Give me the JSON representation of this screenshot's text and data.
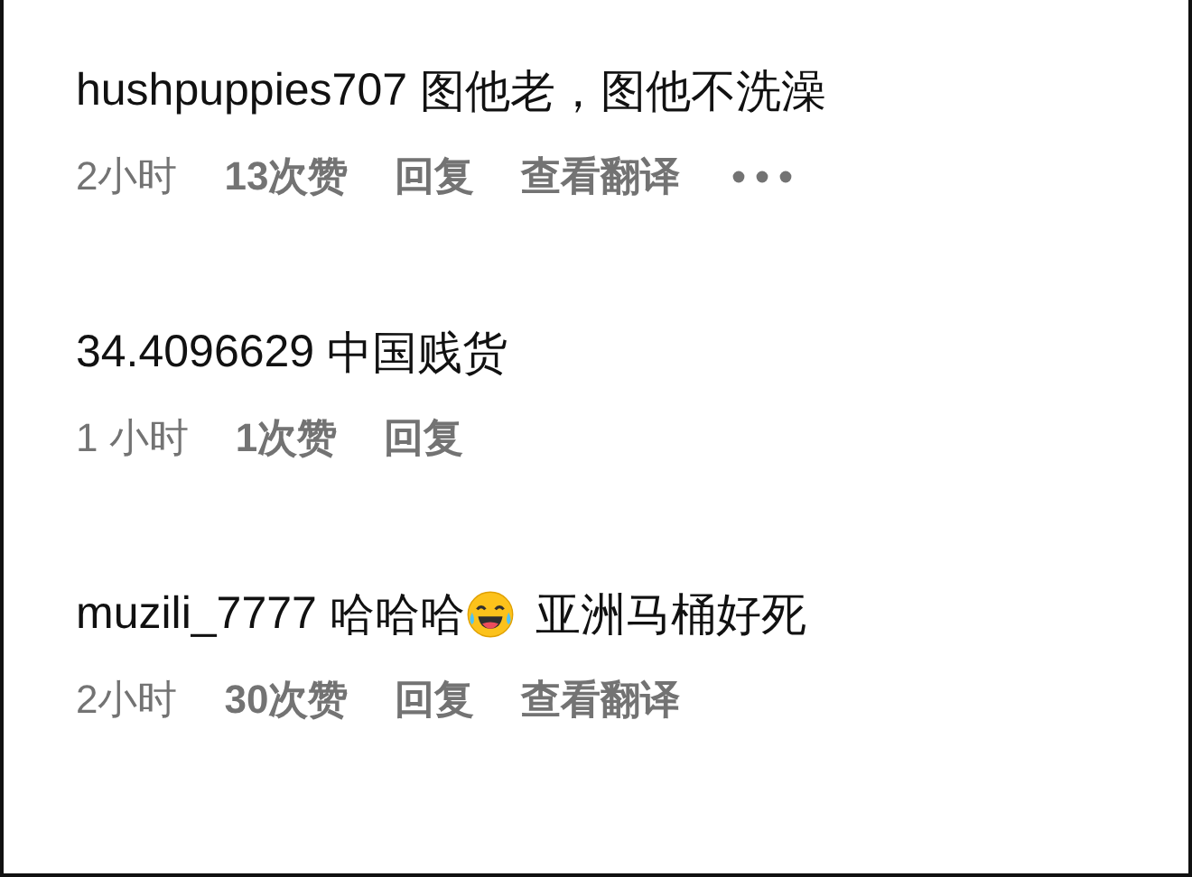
{
  "comments": [
    {
      "username": "hushpuppies707",
      "body": [
        {
          "kind": "text",
          "text": "图他老，图他不洗澡"
        }
      ],
      "meta": [
        {
          "kind": "time",
          "text": "2小时"
        },
        {
          "kind": "likes",
          "text": "13次赞"
        },
        {
          "kind": "action",
          "text": "回复"
        },
        {
          "kind": "action",
          "text": "查看翻译"
        },
        {
          "kind": "more"
        }
      ]
    },
    {
      "username": "34.4096629",
      "body": [
        {
          "kind": "text",
          "text": "中国贱货"
        }
      ],
      "meta": [
        {
          "kind": "time",
          "text": "1 小时"
        },
        {
          "kind": "likes",
          "text": "1次赞"
        },
        {
          "kind": "action",
          "text": "回复"
        }
      ]
    },
    {
      "username": "muzili_7777",
      "body": [
        {
          "kind": "text",
          "text": "哈哈哈"
        },
        {
          "kind": "emoji"
        },
        {
          "kind": "text",
          "text": "亚洲马桶好死"
        }
      ],
      "meta": [
        {
          "kind": "time",
          "text": "2小时"
        },
        {
          "kind": "likes",
          "text": "30次赞"
        },
        {
          "kind": "action",
          "text": "回复"
        },
        {
          "kind": "action",
          "text": "查看翻译"
        }
      ]
    }
  ]
}
